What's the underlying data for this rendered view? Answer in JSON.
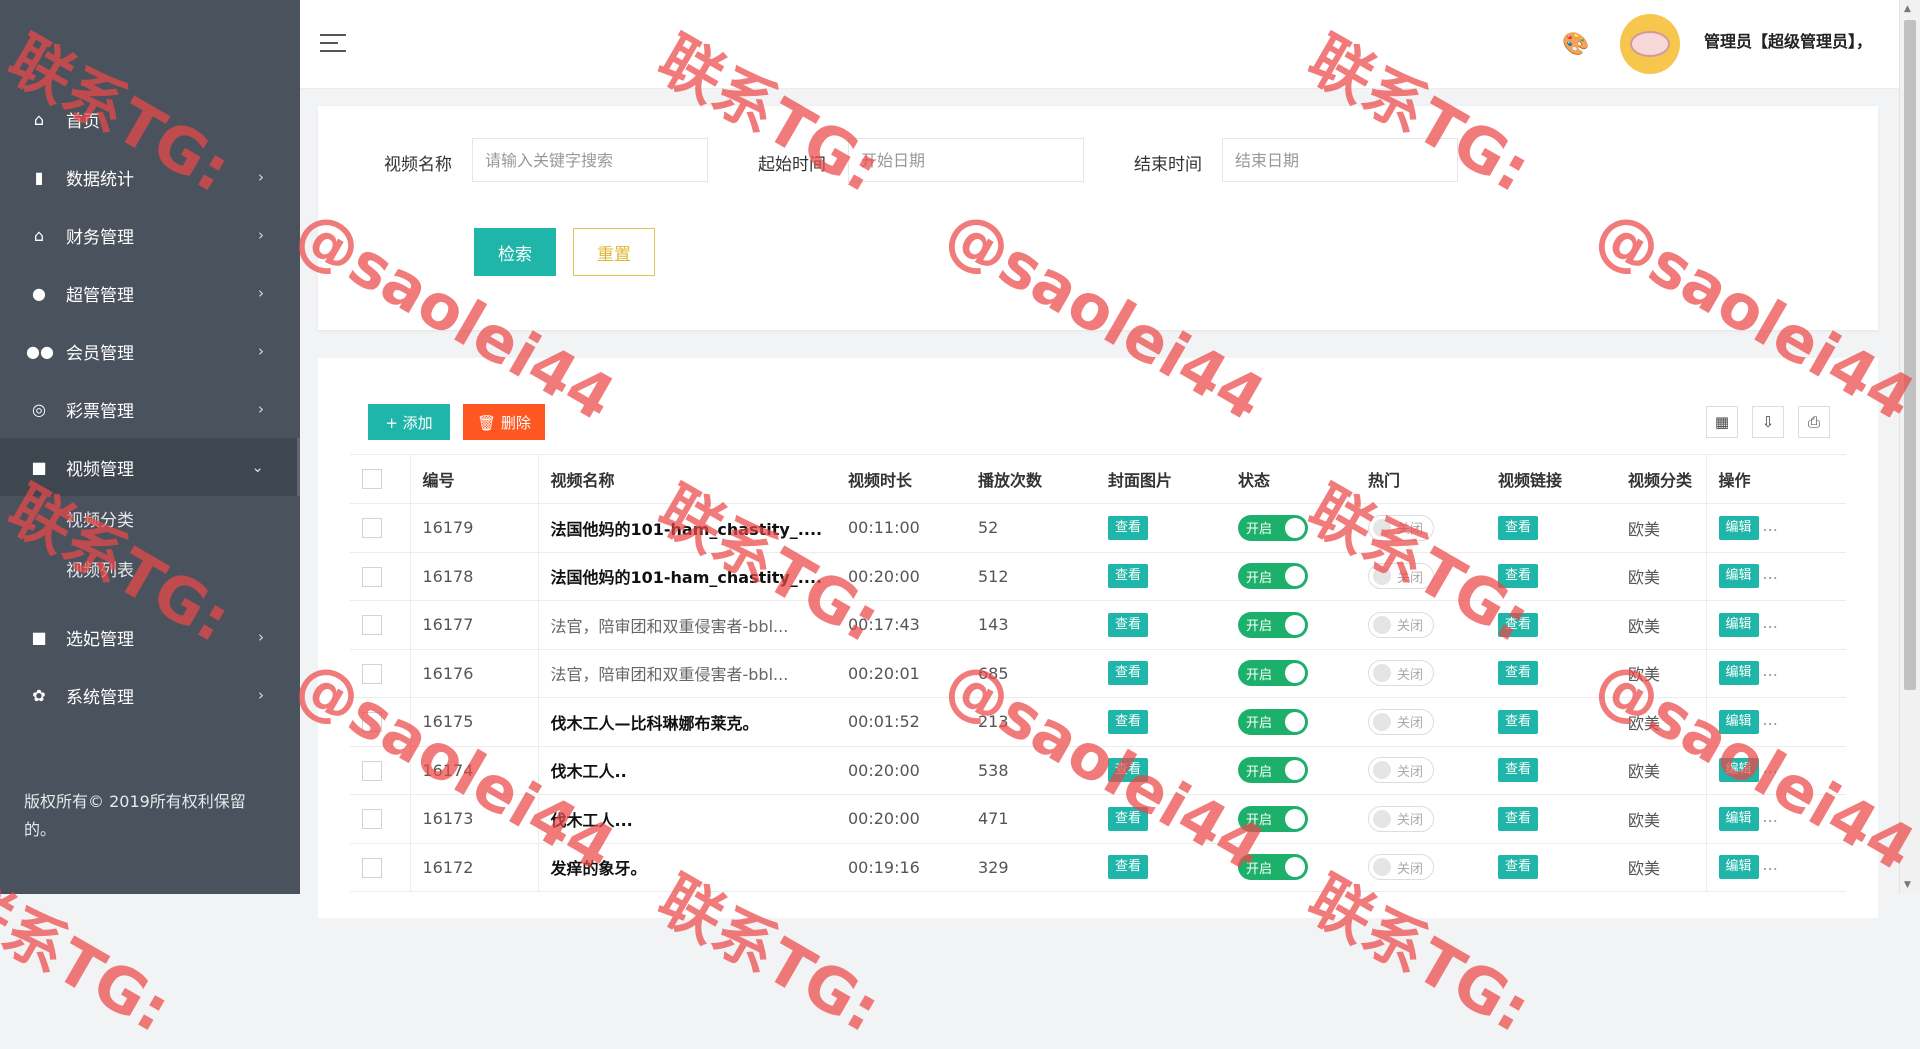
{
  "sidebar": {
    "items": [
      {
        "label": "首页",
        "icon": "home-icon",
        "glyph": "⌂",
        "arrow": ""
      },
      {
        "label": "数据统计",
        "icon": "bar-chart-icon",
        "glyph": "▮",
        "arrow": "›"
      },
      {
        "label": "财务管理",
        "icon": "bank-icon",
        "glyph": "⌂",
        "arrow": "›"
      },
      {
        "label": "超管管理",
        "icon": "user-icon",
        "glyph": "●",
        "arrow": "›"
      },
      {
        "label": "会员管理",
        "icon": "users-icon",
        "glyph": "●●",
        "arrow": "›"
      },
      {
        "label": "彩票管理",
        "icon": "gamepad-icon",
        "glyph": "◎",
        "arrow": "›"
      },
      {
        "label": "视频管理",
        "icon": "video-icon",
        "glyph": "■",
        "arrow": "⌄"
      }
    ],
    "video_sub": [
      "视频分类",
      "视频列表"
    ],
    "items_bottom": [
      {
        "label": "选妃管理",
        "icon": "video-icon",
        "glyph": "■",
        "arrow": "›"
      },
      {
        "label": "系统管理",
        "icon": "gear-icon",
        "glyph": "✿",
        "arrow": "›"
      }
    ],
    "copyright": "版权所有© 2019所有权利保留的。"
  },
  "header": {
    "admin": "管理员【超级管理员】，"
  },
  "search": {
    "name_label": "视频名称",
    "name_placeholder": "请输入关键字搜索",
    "start_label": "起始时间",
    "start_placeholder": "开始日期",
    "end_label": "结束时间",
    "end_placeholder": "结束日期",
    "search_btn": "检索",
    "reset_btn": "重置"
  },
  "toolbar": {
    "add": "+ 添加",
    "delete": "🗑 删除"
  },
  "table": {
    "columns": [
      "编号",
      "视频名称",
      "视频时长",
      "播放次数",
      "封面图片",
      "状态",
      "热门",
      "视频链接",
      "视频分类",
      "操作"
    ],
    "view_label": "查看",
    "on_label": "开启",
    "off_label": "关闭",
    "edit_label": "编辑",
    "more_label": "...",
    "rows": [
      {
        "id": "16179",
        "name": "法国他妈的101-ham_chastity_....",
        "bold": true,
        "duration": "00:11:00",
        "plays": "52",
        "category": "欧美"
      },
      {
        "id": "16178",
        "name": "法国他妈的101-ham_chastity_....",
        "bold": true,
        "duration": "00:20:00",
        "plays": "512",
        "category": "欧美"
      },
      {
        "id": "16177",
        "name": "法官，陪审团和双重侵害者-bbl...",
        "bold": false,
        "duration": "00:17:43",
        "plays": "143",
        "category": "欧美"
      },
      {
        "id": "16176",
        "name": "法官，陪审团和双重侵害者-bbl...",
        "bold": false,
        "duration": "00:20:01",
        "plays": "685",
        "category": "欧美"
      },
      {
        "id": "16175",
        "name": "伐木工人—比科琳娜布莱克。",
        "bold": true,
        "duration": "00:01:52",
        "plays": "213",
        "category": "欧美"
      },
      {
        "id": "16174",
        "name": "伐木工人..",
        "bold": true,
        "duration": "00:20:00",
        "plays": "538",
        "category": "欧美"
      },
      {
        "id": "16173",
        "name": "伐木工人...",
        "bold": true,
        "duration": "00:20:00",
        "plays": "471",
        "category": "欧美"
      },
      {
        "id": "16172",
        "name": "发痒的象牙。",
        "bold": true,
        "duration": "00:19:16",
        "plays": "329",
        "category": "欧美"
      }
    ]
  },
  "watermark": {
    "line1": "联系TG:",
    "line2": "@saolei44"
  }
}
